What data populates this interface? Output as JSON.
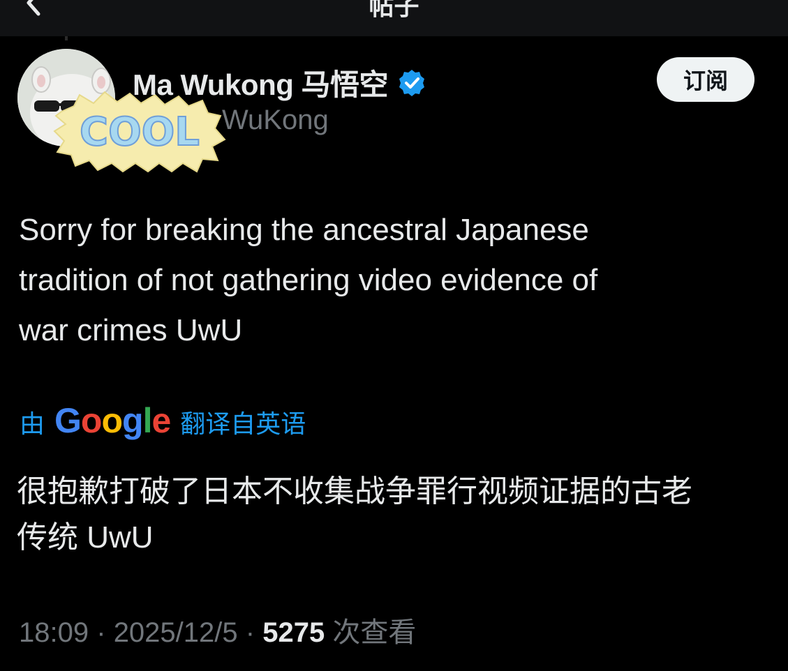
{
  "header": {
    "title": "帖子",
    "back_icon": "chevron-left-icon"
  },
  "author": {
    "display_name": "Ma Wukong 马悟空",
    "handle_visible": "WuKong",
    "verified_icon": "verified-badge-icon",
    "verified_color": "#1d9bf0",
    "avatar_icon": "cartoon-avatar-with-sunglasses",
    "sticker_text": "COOL"
  },
  "subscribe_button": {
    "label": "订阅"
  },
  "tweet": {
    "text": "Sorry for breaking the ancestral Japanese\ntradition of not gathering video evidence of\nwar crimes UwU"
  },
  "translation": {
    "prefix": "由",
    "provider": "Google",
    "suffix": "翻译自英语",
    "text": "很抱歉打破了日本不收集战争罪行视频证据的古老\n传统 UwU"
  },
  "meta": {
    "time": "18:09",
    "date": "2025/12/5",
    "views": "5275",
    "views_label": "次查看",
    "separator": "·"
  },
  "colors": {
    "background": "#000000",
    "text": "#e7e9ea",
    "secondary": "#71767b",
    "link": "#1d9bf0"
  }
}
